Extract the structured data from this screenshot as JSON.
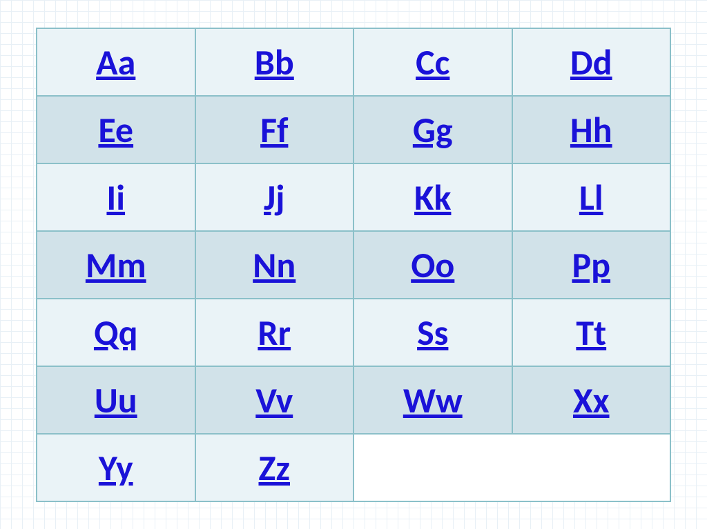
{
  "alphabet_table": {
    "rows": [
      [
        "Aa",
        "Bb",
        "Cc",
        "Dd"
      ],
      [
        "Ee",
        "Ff",
        "Gg",
        "Hh"
      ],
      [
        "Ii",
        "Jj",
        "Kk",
        "Ll"
      ],
      [
        "Mm",
        "Nn",
        "Oo",
        "Pp"
      ],
      [
        "Qq",
        "Rr",
        "Ss",
        "Tt"
      ],
      [
        "Uu",
        "Vv",
        "Ww",
        "Xx"
      ],
      [
        "Yy",
        "Zz",
        "",
        ""
      ]
    ]
  },
  "colors": {
    "border": "#8bc0c9",
    "row_light": "#eaf3f7",
    "row_dark": "#d1e2e9",
    "link": "#1a12d8",
    "grid": "#e8f0f6"
  }
}
